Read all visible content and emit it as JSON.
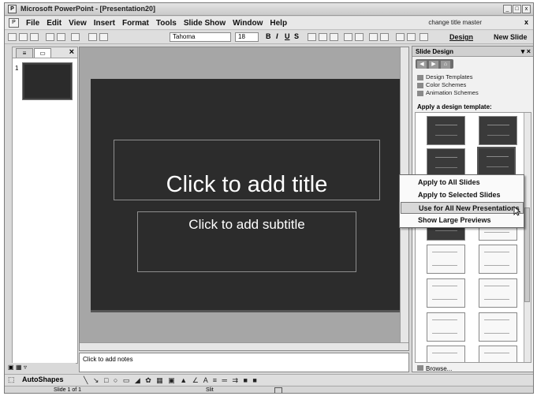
{
  "window": {
    "title": "Microsoft PowerPoint - [Presentation20]"
  },
  "menubar": {
    "items": [
      "File",
      "Edit",
      "View",
      "Insert",
      "Format",
      "Tools",
      "Slide Show",
      "Window",
      "Help"
    ],
    "help_box": "change title master",
    "close_label": "x"
  },
  "toolbar": {
    "font_name": "Tahoma",
    "font_size": "18",
    "format_buttons": [
      "B",
      "I",
      "U",
      "S"
    ],
    "design_label": "Design",
    "new_slide_label": "New Slide"
  },
  "slides_pane": {
    "slide_number": "1"
  },
  "slide": {
    "title_placeholder": "Click to add title",
    "subtitle_placeholder": "Click to add subtitle"
  },
  "notes": {
    "placeholder": "Click to add notes"
  },
  "task_pane": {
    "title": "Slide Design",
    "links": [
      "Design Templates",
      "Color Schemes",
      "Animation Schemes"
    ],
    "section_label": "Apply a design template:",
    "browse_label": "Browse..."
  },
  "context_menu": {
    "items": [
      "Apply to All Slides",
      "Apply to Selected Slides",
      "Use for All New Presentations",
      "Show Large Previews"
    ],
    "highlighted_index": 2
  },
  "drawing_toolbar": {
    "autoshapes_label": "AutoShapes"
  },
  "status_bar": {
    "slide_text": "Slide 1 of 1",
    "language": "Slit"
  }
}
